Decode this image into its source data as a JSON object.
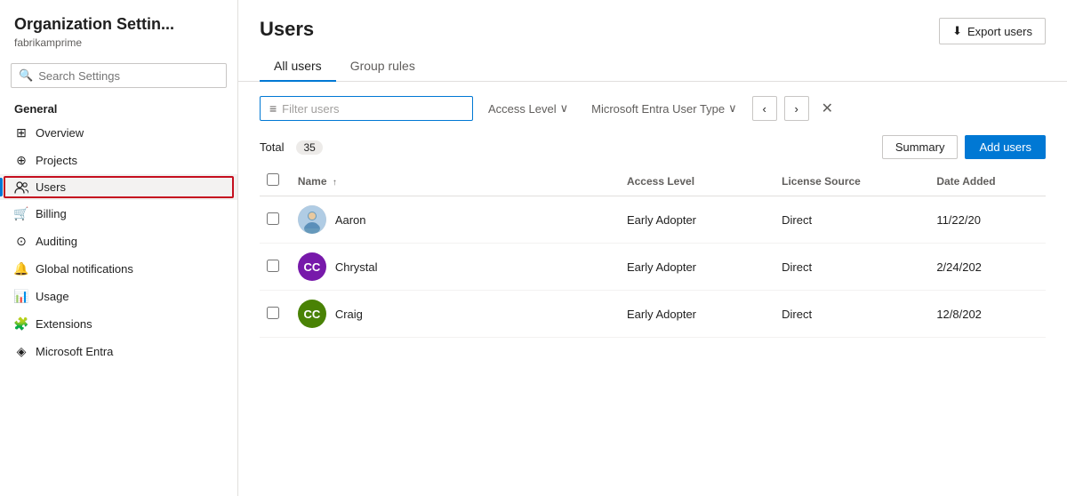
{
  "app": {
    "title": "Organization Settin...",
    "subtitle": "fabrikamprime"
  },
  "sidebar": {
    "search_placeholder": "Search Settings",
    "section_general": "General",
    "items": [
      {
        "id": "overview",
        "label": "Overview",
        "icon": "⊞"
      },
      {
        "id": "projects",
        "label": "Projects",
        "icon": "⊕"
      },
      {
        "id": "users",
        "label": "Users",
        "icon": "👥",
        "active": true
      },
      {
        "id": "billing",
        "label": "Billing",
        "icon": "🛒"
      },
      {
        "id": "auditing",
        "label": "Auditing",
        "icon": "⊙"
      },
      {
        "id": "global-notifications",
        "label": "Global notifications",
        "icon": "🔔"
      },
      {
        "id": "usage",
        "label": "Usage",
        "icon": "📊"
      },
      {
        "id": "extensions",
        "label": "Extensions",
        "icon": "🧩"
      },
      {
        "id": "microsoft-entra",
        "label": "Microsoft Entra",
        "icon": "◈"
      }
    ]
  },
  "main": {
    "title": "Users",
    "tabs": [
      {
        "id": "all-users",
        "label": "All users",
        "active": true
      },
      {
        "id": "group-rules",
        "label": "Group rules",
        "active": false
      }
    ],
    "export_btn": "Export users",
    "filter_placeholder": "Filter users",
    "access_level_label": "Access Level",
    "entra_user_type_label": "Microsoft Entra User Type",
    "total_label": "Total",
    "total_count": "35",
    "summary_btn": "Summary",
    "add_users_btn": "Add users",
    "table": {
      "columns": [
        "",
        "Name",
        "Access Level",
        "License Source",
        "Date Added"
      ],
      "rows": [
        {
          "id": "aaron",
          "name": "Aaron",
          "access_level": "Early Adopter",
          "license_source": "Direct",
          "date_added": "11/22/20",
          "avatar_color": "#c8c6c4",
          "avatar_initials": "",
          "has_photo": true
        },
        {
          "id": "chrystal",
          "name": "Chrystal",
          "access_level": "Early Adopter",
          "license_source": "Direct",
          "date_added": "2/24/202",
          "avatar_color": "#7719aa",
          "avatar_initials": "CC",
          "has_photo": false
        },
        {
          "id": "craig",
          "name": "Craig",
          "access_level": "Early Adopter",
          "license_source": "Direct",
          "date_added": "12/8/202",
          "avatar_color": "#498205",
          "avatar_initials": "CC",
          "has_photo": false
        }
      ]
    }
  },
  "icons": {
    "search": "🔍",
    "export": "⬇",
    "filter": "≡",
    "chevron_down": "∨",
    "chevron_left": "‹",
    "chevron_right": "›",
    "close": "✕",
    "sort_asc": "↑"
  }
}
